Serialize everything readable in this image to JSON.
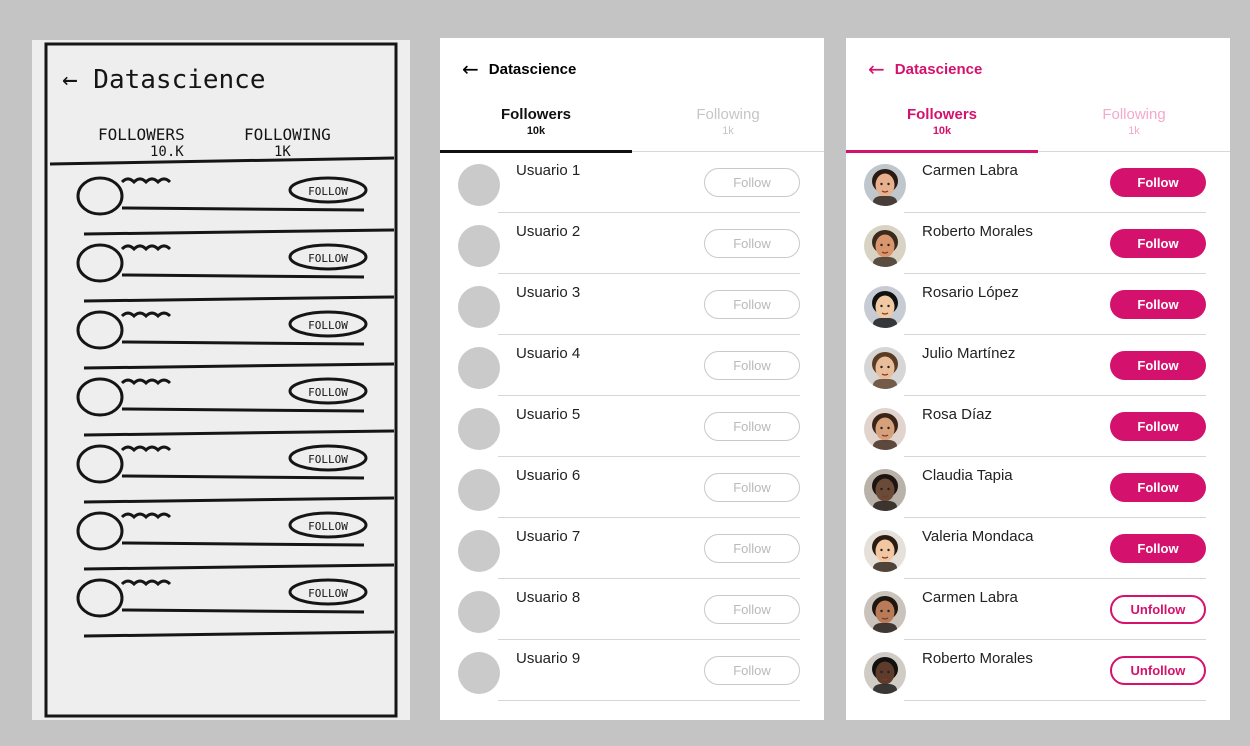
{
  "sketch": {
    "title": "← Datascience",
    "tab_followers": "FOLLOWERS",
    "tab_followers_count": "10.K",
    "tab_following": "FOLLOWING",
    "tab_following_count": "1K",
    "follow_scribble": "FOLLOW"
  },
  "wireframe": {
    "back_icon": "←",
    "title": "Datascience",
    "tabs": [
      {
        "label": "Followers",
        "count": "10k"
      },
      {
        "label": "Following",
        "count": "1k"
      }
    ],
    "users": [
      {
        "name": "Usuario 1",
        "action": "Follow"
      },
      {
        "name": "Usuario 2",
        "action": "Follow"
      },
      {
        "name": "Usuario 3",
        "action": "Follow"
      },
      {
        "name": "Usuario 4",
        "action": "Follow"
      },
      {
        "name": "Usuario 5",
        "action": "Follow"
      },
      {
        "name": "Usuario 6",
        "action": "Follow"
      },
      {
        "name": "Usuario 7",
        "action": "Follow"
      },
      {
        "name": "Usuario 8",
        "action": "Follow"
      },
      {
        "name": "Usuario 9",
        "action": "Follow"
      }
    ]
  },
  "mockup": {
    "back_icon": "←",
    "title": "Datascience",
    "accent_color": "#d4126d",
    "tabs": [
      {
        "label": "Followers",
        "count": "10k"
      },
      {
        "label": "Following",
        "count": "1k"
      }
    ],
    "users": [
      {
        "name": "Carmen Labra",
        "action": "Follow"
      },
      {
        "name": "Roberto Morales",
        "action": "Follow"
      },
      {
        "name": "Rosario López",
        "action": "Follow"
      },
      {
        "name": "Julio Martínez",
        "action": "Follow"
      },
      {
        "name": "Rosa Díaz",
        "action": "Follow"
      },
      {
        "name": "Claudia Tapia",
        "action": "Follow"
      },
      {
        "name": "Valeria Mondaca",
        "action": "Follow"
      },
      {
        "name": "Carmen Labra",
        "action": "Unfollow"
      },
      {
        "name": "Roberto Morales",
        "action": "Unfollow"
      }
    ]
  }
}
